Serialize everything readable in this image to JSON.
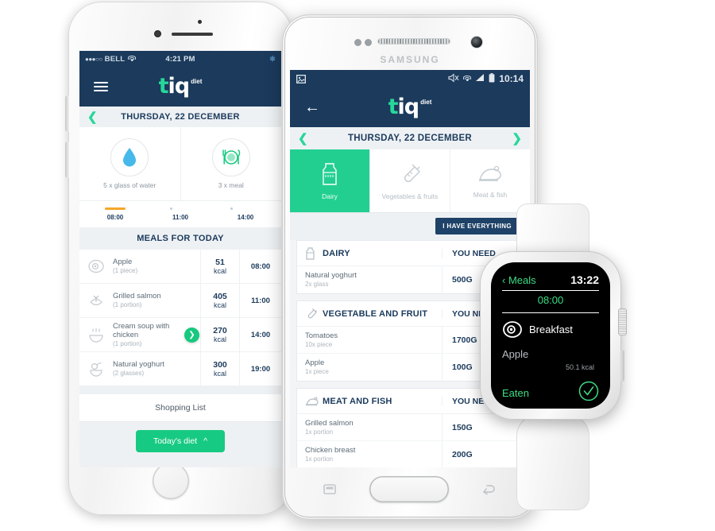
{
  "brand": {
    "logo_t": "t",
    "logo_iq": "iq",
    "logo_sub": "diet",
    "accent_green": "#22cf91",
    "navy": "#1b3a5c",
    "watch_green": "#3ddc84"
  },
  "iphone": {
    "status_bar": {
      "signal_dots": "●●●○○",
      "carrier": "BELL",
      "wifi_icon": "wifi-icon",
      "time": "4:21 PM",
      "bluetooth_icon": "bluetooth-icon"
    },
    "navbar": {
      "menu_icon": "hamburger-menu-icon"
    },
    "date_bar": {
      "prev_icon": "chevron-left-icon",
      "date": "THURSDAY, 22 DECEMBER"
    },
    "summary": [
      {
        "icon": "water-drop-icon",
        "label": "5 x glass of water"
      },
      {
        "icon": "plate-cutlery-icon",
        "label": "3 x meal"
      }
    ],
    "timeline": {
      "ticks": [
        "08:00",
        "11:00",
        "14:00"
      ],
      "progress_color": "#f4a62a"
    },
    "meals_header": "MEALS FOR TODAY",
    "meals": [
      {
        "icon": "egg-icon",
        "name": "Apple",
        "portion": "(1 piece)",
        "kcal": "51",
        "unit": "kcal",
        "time": "08:00",
        "has_go": false
      },
      {
        "icon": "fish-icon",
        "name": "Grilled salmon",
        "portion": "(1 portion)",
        "kcal": "405",
        "unit": "kcal",
        "time": "11:00",
        "has_go": false
      },
      {
        "icon": "soup-icon",
        "name": "Cream soup with chicken",
        "portion": "(1 portion)",
        "kcal": "270",
        "unit": "kcal",
        "time": "14:00",
        "has_go": true
      },
      {
        "icon": "yoghurt-icon",
        "name": "Natural yoghurt",
        "portion": "(2 glasses)",
        "kcal": "300",
        "unit": "kcal",
        "time": "19:00",
        "has_go": false
      }
    ],
    "shopping_list_label": "Shopping List",
    "cta": {
      "label": "Today's diet",
      "icon": "chevron-up-icon"
    }
  },
  "samsung": {
    "brand_text": "SAMSUNG",
    "status_bar": {
      "image_icon": "image-icon",
      "mute_icon": "mute-icon",
      "wifi_icon": "wifi-icon",
      "signal_icon": "signal-bars-icon",
      "battery_icon": "battery-icon",
      "time": "10:14"
    },
    "navbar": {
      "back_icon": "arrow-left-icon"
    },
    "date_bar": {
      "prev_icon": "chevron-left-icon",
      "date": "THURSDAY, 22 DECEMBER",
      "next_icon": "chevron-right-icon"
    },
    "tabs": [
      {
        "icon": "milk-carton-icon",
        "label": "Dairy",
        "active": true
      },
      {
        "icon": "carrot-icon",
        "label": "Vegetables & fruits",
        "active": false
      },
      {
        "icon": "roast-chicken-icon",
        "label": "Meat & fish",
        "active": false
      }
    ],
    "have_everything_button": "I HAVE EVERYTHING",
    "shopping_sections": [
      {
        "icon": "milk-carton-icon",
        "title": "DAIRY",
        "need_label": "YOU NEED",
        "rows": [
          {
            "name": "Natural yoghurt",
            "portion": "2x glass",
            "qty": "500G"
          }
        ]
      },
      {
        "icon": "carrot-icon",
        "title": "VEGETABLE AND FRUIT",
        "need_label": "YOU NEED",
        "rows": [
          {
            "name": "Tomatoes",
            "portion": "10x piece",
            "qty": "1700G"
          },
          {
            "name": "Apple",
            "portion": "1x piece",
            "qty": "100G"
          }
        ]
      },
      {
        "icon": "roast-chicken-icon",
        "title": "MEAT AND FISH",
        "need_label": "YOU NEED",
        "rows": [
          {
            "name": "Grilled salmon",
            "portion": "1x portion",
            "qty": "150G"
          },
          {
            "name": "Chicken breast",
            "portion": "1x portion",
            "qty": "200G"
          }
        ]
      }
    ],
    "nav_buttons": {
      "recent_icon": "recent-apps-icon",
      "back_icon": "back-arrow-icon"
    }
  },
  "watch": {
    "back_icon": "chevron-left-icon",
    "back_label": "Meals",
    "time": "13:22",
    "slot_time": "08:00",
    "meal_icon": "egg-icon",
    "meal_title": "Breakfast",
    "item_name": "Apple",
    "item_kcal": "50.1 kcal",
    "eaten_label": "Eaten",
    "eaten_icon": "check-circle-icon"
  }
}
